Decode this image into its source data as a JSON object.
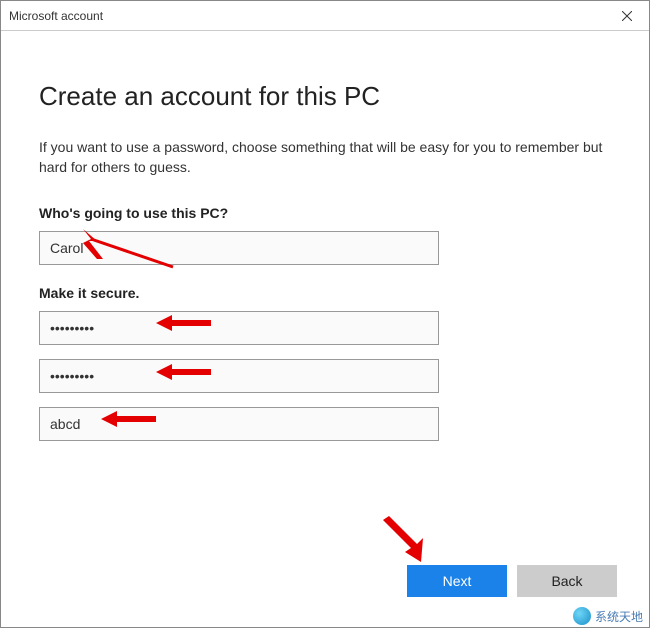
{
  "window": {
    "title": "Microsoft account"
  },
  "heading": "Create an account for this PC",
  "description": "If you want to use a password, choose something that will be easy for you to remember but hard for others to guess.",
  "section_user": {
    "label": "Who's going to use this PC?",
    "username_value": "Carol"
  },
  "section_secure": {
    "label": "Make it secure.",
    "password_value": "•••••••••",
    "confirm_value": "•••••••••",
    "hint_value": "abcd"
  },
  "footer": {
    "next_label": "Next",
    "back_label": "Back"
  },
  "watermark": "系统天地"
}
